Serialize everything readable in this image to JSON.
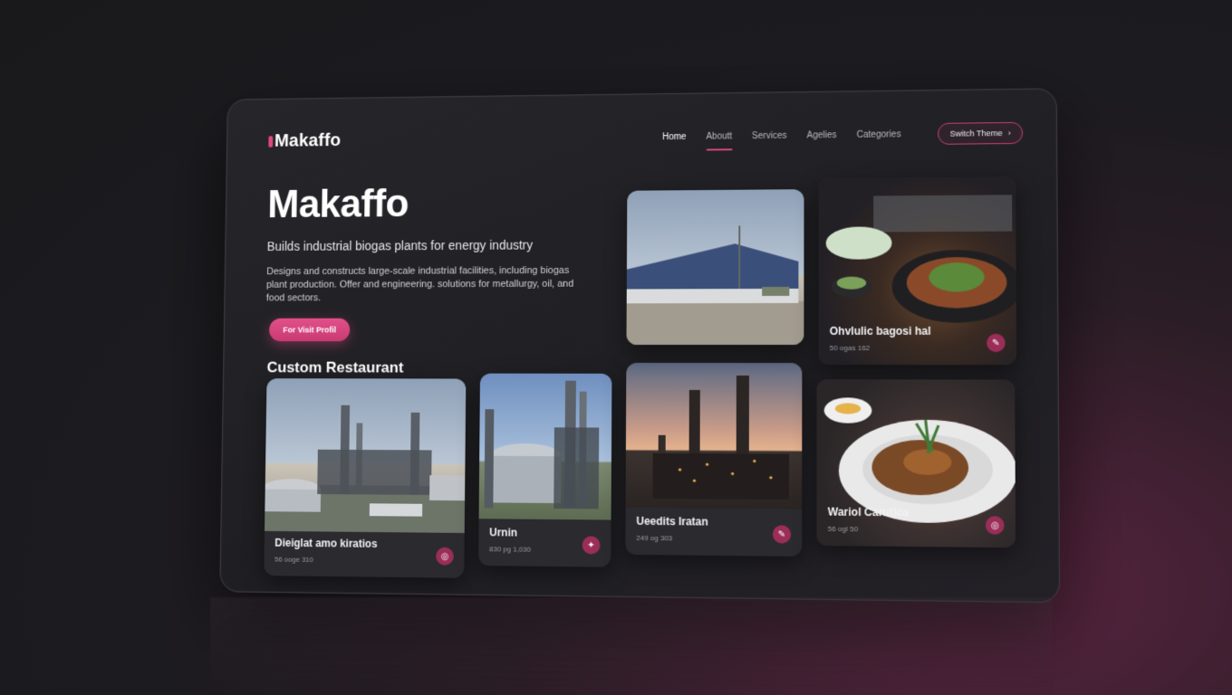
{
  "brand": {
    "name": "Makaffo"
  },
  "nav": {
    "items": [
      {
        "label": "Home",
        "active": true
      },
      {
        "label": "Aboutt",
        "active": false,
        "underline": true
      },
      {
        "label": "Services",
        "active": false
      },
      {
        "label": "Agelies",
        "active": false
      },
      {
        "label": "Categories",
        "active": false
      }
    ],
    "theme_button": "Switch Theme",
    "theme_icon": "chevron-right-icon"
  },
  "hero": {
    "title": "Makaffo",
    "subtitle": "Builds industrial biogas plants for energy industry",
    "description": "Designs and constructs large-scale industrial facilities, including biogas plant production. Offer and engineering. solutions for metallurgy, oil, and food sectors.",
    "cta_label": "For Visit Profil"
  },
  "section": {
    "title": "Custom Restaurant"
  },
  "cards": [
    {
      "caption": "Dieiglat amo kiratios",
      "meta": "56 ooge 310",
      "icon": "target-icon"
    },
    {
      "caption": "Urnin",
      "meta": "830 pg 1,030",
      "icon": "leaf-icon"
    },
    {
      "caption": "Ueedits Iratan",
      "meta": "249 og 303",
      "icon": "pen-icon"
    },
    {
      "caption": "",
      "meta": "",
      "icon": ""
    },
    {
      "caption": "Ohvlulic bagosi hal",
      "meta": "50 ogas 162",
      "icon": "pen-icon"
    },
    {
      "caption": "Wariol Carutica",
      "meta": "56 ogl 50",
      "icon": "target-icon"
    }
  ],
  "colors": {
    "accent": "#d6457c",
    "panel": "#222226",
    "background": "#19191c"
  }
}
